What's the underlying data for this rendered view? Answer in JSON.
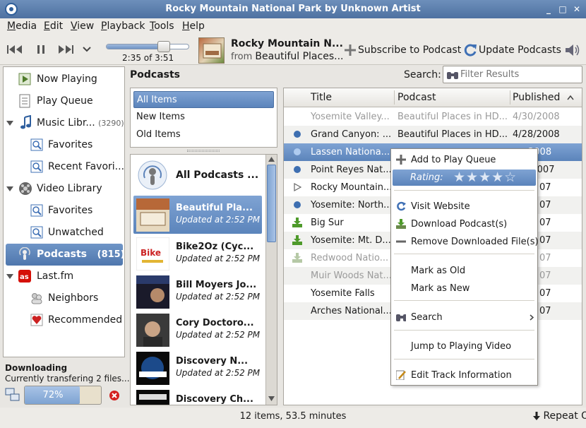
{
  "window": {
    "title": "Rocky Mountain National Park by Unknown Artist"
  },
  "menu": [
    "Media",
    "Edit",
    "View",
    "Playback",
    "Tools",
    "Help"
  ],
  "menu_mnemonic": [
    "M",
    "E",
    "V",
    "P",
    "T",
    "H"
  ],
  "player": {
    "time": "2:35 of 3:51",
    "progress": 0.67,
    "track_title": "Rocky Mountain N...",
    "from_label": "from",
    "album": "Beautiful Places..."
  },
  "toolbar": {
    "subscribe_label": "Subscribe to Podcast",
    "update_label": "Update Podcasts"
  },
  "sidebar": {
    "items": [
      {
        "label": "Now Playing",
        "count": ""
      },
      {
        "label": "Play Queue",
        "count": ""
      },
      {
        "label": "Music Libr...",
        "count": "(3290)"
      },
      {
        "label": "Favorites",
        "count": ""
      },
      {
        "label": "Recent Favori...",
        "count": ""
      },
      {
        "label": "Video Library",
        "count": ""
      },
      {
        "label": "Favorites",
        "count": ""
      },
      {
        "label": "Unwatched",
        "count": ""
      },
      {
        "label": "Podcasts",
        "count": "(815)"
      },
      {
        "label": "Last.fm",
        "count": ""
      },
      {
        "label": "Neighbors",
        "count": ""
      },
      {
        "label": "Recommended",
        "count": ""
      }
    ]
  },
  "downloading": {
    "title": "Downloading",
    "subtitle": "Currently transfering 2 files...",
    "percent_label": "72%",
    "percent": 72
  },
  "podcasts_pane": {
    "title": "Podcasts",
    "search_label": "Search:",
    "search_placeholder": "Filter Results",
    "filters": [
      "All Items",
      "New Items",
      "Old Items"
    ],
    "feeds": [
      {
        "name": "All Podcasts ...",
        "updated": ""
      },
      {
        "name": "Beautiful Pla...",
        "updated": "Updated at 2:52 PM"
      },
      {
        "name": "Bike2Oz (Cyc...",
        "updated": "Updated at 2:52 PM"
      },
      {
        "name": "Bill Moyers Jo...",
        "updated": "Updated at 2:52 PM"
      },
      {
        "name": "Cory Doctoro...",
        "updated": "Updated at 2:52 PM"
      },
      {
        "name": "Discovery  N...",
        "updated": "Updated at 2:52 PM"
      },
      {
        "name": "Discovery Ch...",
        "updated": ""
      }
    ]
  },
  "tracks": {
    "columns": [
      "Title",
      "Podcast",
      "Published"
    ],
    "rows": [
      {
        "title": "Yosemite Valley...",
        "podcast": "Beautiful Places in HD...",
        "published": "4/30/2008",
        "status": "none"
      },
      {
        "title": "Grand Canyon: ...",
        "podcast": "Beautiful Places in HD...",
        "published": "4/28/2008",
        "status": "new"
      },
      {
        "title": "Lassen Nationa...",
        "podcast": "",
        "published": "2008",
        "status": "new"
      },
      {
        "title": "Point Reyes Nat...",
        "podcast": "",
        "published": "/2007",
        "status": "new"
      },
      {
        "title": "Rocky Mountain...",
        "podcast": "",
        "published": "07",
        "status": "playing"
      },
      {
        "title": "Yosemite: North...",
        "podcast": "",
        "published": "07",
        "status": "new"
      },
      {
        "title": "Big Sur",
        "podcast": "",
        "published": "07",
        "status": "downloaded"
      },
      {
        "title": "Yosemite: Mt. D...",
        "podcast": "",
        "published": "07",
        "status": "downloaded"
      },
      {
        "title": "Redwood Natio...",
        "podcast": "",
        "published": "07",
        "status": "downloaded-dim"
      },
      {
        "title": "Muir Woods Nat...",
        "podcast": "",
        "published": "07",
        "status": "none"
      },
      {
        "title": "Yosemite Falls",
        "podcast": "",
        "published": "07",
        "status": "none"
      },
      {
        "title": "Arches National...",
        "podcast": "",
        "published": "07",
        "status": "none"
      }
    ]
  },
  "context_menu": {
    "add_to_queue": "Add to Play Queue",
    "rating_label": "Rating:",
    "rating": 4,
    "rating_max": 5,
    "visit_website": "Visit Website",
    "download": "Download Podcast(s)",
    "remove_downloaded": "Remove Downloaded File(s)",
    "mark_old": "Mark as Old",
    "mark_new": "Mark as New",
    "search": "Search",
    "jump": "Jump to Playing Video",
    "edit_info": "Edit Track Information"
  },
  "statusbar": {
    "summary": "12 items, 53.5 minutes",
    "repeat_label": "Repeat Off"
  }
}
